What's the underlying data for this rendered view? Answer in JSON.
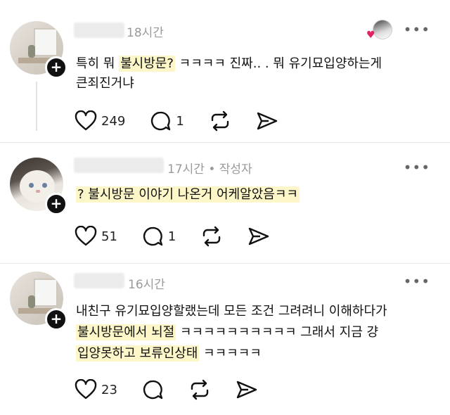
{
  "posts": [
    {
      "time": "18시간",
      "line1_pre": "특히 뭐 ",
      "line1_hl": "불시방문?",
      "line1_post": " ㅋㅋㅋㅋ 진짜.. . 뭐 유기묘입양하는게",
      "line2": "큰죄진거냐",
      "likes": "249",
      "replies": "1"
    },
    {
      "time": "17시간 • 작성자",
      "line1_hl": "? 불시방문 이야기 나온거 어케알았음ㅋㅋ",
      "likes": "51",
      "replies": "1"
    },
    {
      "time": "16시간",
      "line1": "내친구 유기묘입양할랬는데 모든 조건 그려려니 이해하다가",
      "line2_hl": "불시방문에서 뇌절",
      "line2_post": " ㅋㅋㅋㅋㅋㅋㅋㅋㅋㅋ 그래서 지금 걍",
      "line3_hl": "입양못하고 보류인상태",
      "line3_post": " ㅋㅋㅋㅋㅋ",
      "likes": "23"
    }
  ],
  "icons": [
    "heart-icon",
    "comment-icon",
    "repost-icon",
    "share-icon",
    "more-icon",
    "plus-icon"
  ]
}
